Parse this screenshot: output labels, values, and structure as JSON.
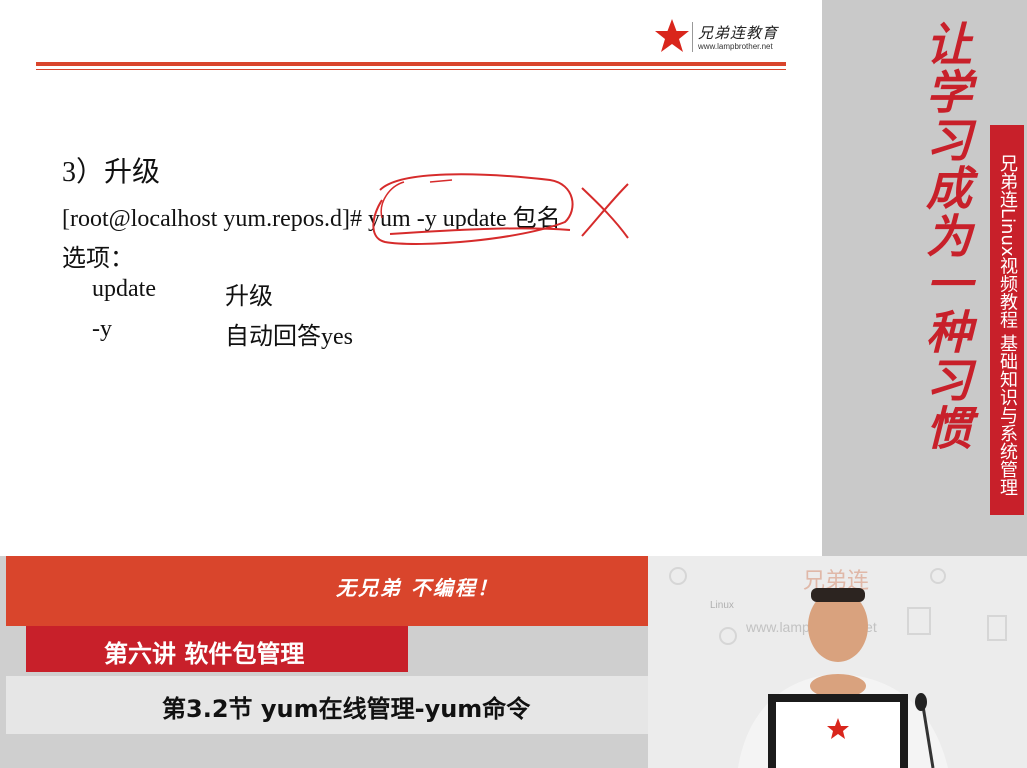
{
  "slide": {
    "logo_text": "兄弟连教育",
    "logo_url": "www.lampbrother.net",
    "section_title": "3）升级",
    "command": "[root@localhost yum.repos.d]# yum -y update 包名",
    "options_heading": "选项：",
    "options": [
      {
        "flag": "update",
        "desc": "升级"
      },
      {
        "flag": "-y",
        "desc": "自动回答yes"
      }
    ],
    "annotation_color": "#d62b2b"
  },
  "sidebar": {
    "slogan": "让学习成为一种习惯",
    "course": "兄弟连Linux视频教程  基础知识与系统管理"
  },
  "lower_third": {
    "tagline": "无兄弟 不编程！",
    "lecture": "第六讲 软件包管理",
    "section": "第3.2节 yum在线管理-yum命令"
  },
  "video": {
    "watermark_brand": "兄弟连",
    "watermark_url": "www.lampbrother.net",
    "watermark_linux": "Linux"
  },
  "colors": {
    "brand_red": "#c8202a",
    "band_red": "#d9452c"
  }
}
